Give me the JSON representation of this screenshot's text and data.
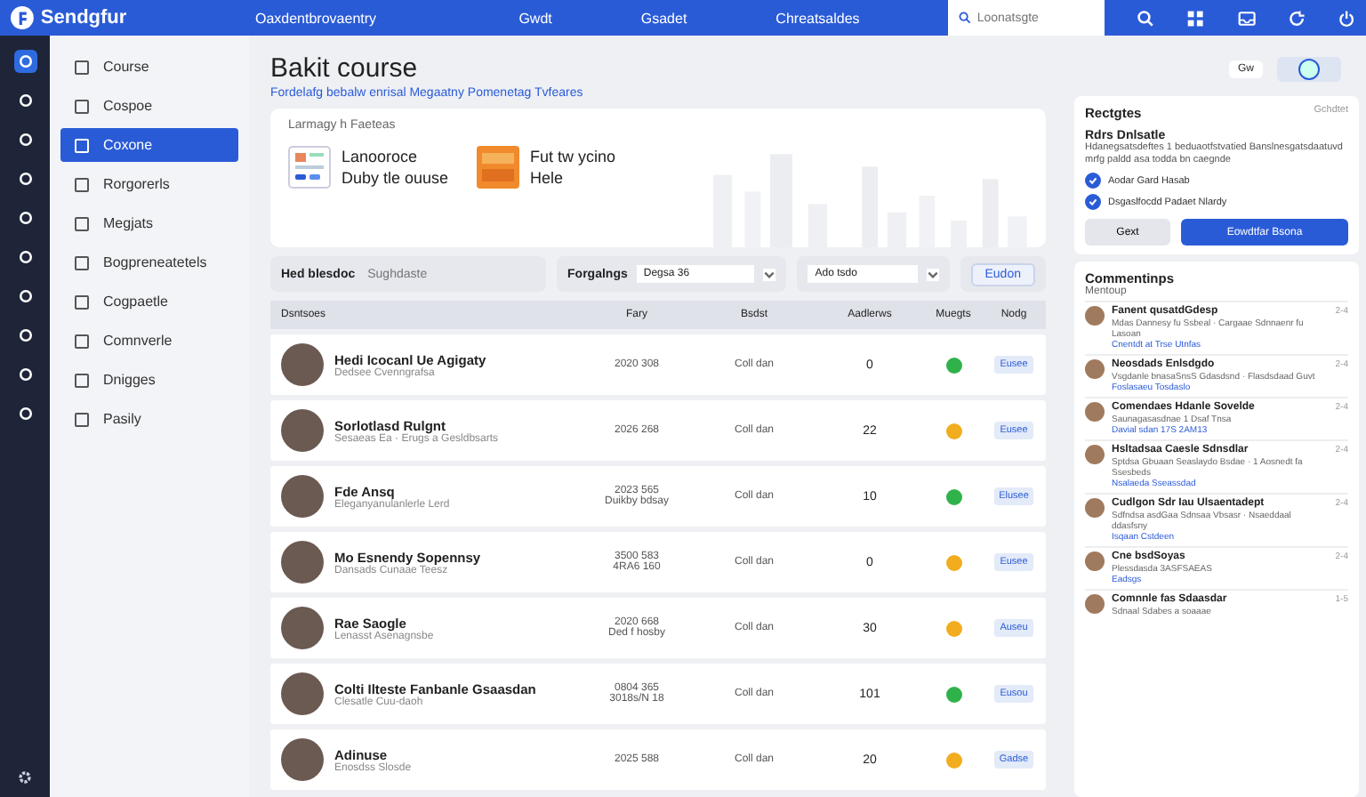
{
  "topbar": {
    "logo": "Sendgfur",
    "breadcrumb": "Oaxdentbrovaentry",
    "nav": [
      {
        "label": "Gwdt"
      },
      {
        "label": "Gsadet"
      },
      {
        "label": "Chreatsaldes"
      }
    ],
    "search": {
      "placeholder": "Loonatsgte"
    }
  },
  "rail": {
    "items": [
      {
        "selected": true
      },
      {
        "selected": false
      },
      {
        "selected": false
      },
      {
        "selected": false
      },
      {
        "selected": false
      },
      {
        "selected": false
      },
      {
        "selected": false
      },
      {
        "selected": false
      },
      {
        "selected": false
      },
      {
        "selected": false
      }
    ]
  },
  "sidebar": {
    "items": [
      {
        "label": "Course",
        "selected": false
      },
      {
        "label": "Cospoe",
        "selected": false
      },
      {
        "label": "Coxone",
        "selected": true
      },
      {
        "label": "Rorgorerls",
        "selected": false
      },
      {
        "label": "Megjats",
        "selected": false
      },
      {
        "label": "Bogpreneatetels",
        "selected": false
      },
      {
        "label": "Cogpaetle",
        "selected": false
      },
      {
        "label": "Comnverle",
        "selected": false
      },
      {
        "label": "Dnigges",
        "selected": false
      },
      {
        "label": "Pasily",
        "selected": false
      }
    ]
  },
  "page": {
    "title": "Bakit course",
    "subtitle": "Fordelafg bebalw enrisal Megaatny Pomenetag Tvfeares",
    "chip": "Gw"
  },
  "learning": {
    "title": "Larmagy h Faeteas",
    "items": [
      {
        "kind": "calendar",
        "line1": "Lanooroce",
        "line2": "Duby tle ouuse"
      },
      {
        "kind": "video",
        "line1": "Fut tw ycino",
        "line2": "Hele"
      }
    ]
  },
  "filters": {
    "label": "Hed blesdoc",
    "placeholder": "Sughdaste",
    "select_label": "Forgalngs",
    "select_1": "Degsa 36",
    "select_2": "Ado tsdo",
    "button": "Eudon"
  },
  "table": {
    "columns": [
      "Dsntsoes",
      "Fary",
      "Bsdst",
      "Aadlerws",
      "Muegts",
      "Nodg"
    ],
    "rows": [
      {
        "name": "Hedi Icocanl Ue Agigaty",
        "sub": "Dedsee Cvenngrafsa",
        "fary": [
          "2020 308"
        ],
        "bsdst": "Coll dan",
        "count": "0",
        "color": "#2fb24a",
        "tag": "Eusee"
      },
      {
        "name": "Sorlotlasd Rulgnt",
        "sub": "Sesaeas Ea · Erugs a Gesldbsarts",
        "fary": [
          "2026 268"
        ],
        "bsdst": "Coll dan",
        "count": "22",
        "color": "#f2ad1f",
        "tag": "Eusee"
      },
      {
        "name": "Fde Ansq",
        "sub": "Eleganyanulanlerle Lerd",
        "fary": [
          "2023 565",
          "Duikby bdsay"
        ],
        "bsdst": "Coll dan",
        "count": "10",
        "color": "#2fb24a",
        "tag": "Elusee"
      },
      {
        "name": "Mo Esnendy Sopennsy",
        "sub": "Dansads Cunaae Teesz",
        "fary": [
          "3500 583",
          "4RA6 160"
        ],
        "bsdst": "Coll dan",
        "count": "0",
        "color": "#f2ad1f",
        "tag": "Eusee"
      },
      {
        "name": "Rae Saogle",
        "sub": "Lenasst Asenagnsbe",
        "fary": [
          "2020 668",
          "Ded f hosby"
        ],
        "bsdst": "Coll dan",
        "count": "30",
        "color": "#f2ad1f",
        "tag": "Auseu"
      },
      {
        "name": "Colti Ilteste Fanbanle Gsaasdan",
        "sub": "Clesatle Cuu-daoh",
        "fary": [
          "0804 365",
          "3018s/N 18"
        ],
        "bsdst": "Coll dan",
        "count": "101",
        "color": "#2fb24a",
        "tag": "Eusou"
      },
      {
        "name": "Adinuse",
        "sub": "Enosdss Slosde",
        "fary": [
          "2025 588"
        ],
        "bsdst": "Coll dan",
        "count": "20",
        "color": "#f2ad1f",
        "tag": "Gadse"
      }
    ]
  },
  "requests": {
    "title": "Rectgtes",
    "meta": "Gchdtet",
    "heading": "Rdrs Dnlsatle",
    "text": "Hdanegsatsdeftes 1 beduaotfstvatied Banslnesgatsdaatuvd mrfg paldd asa todda bn caegnde",
    "checks": [
      {
        "label": "Aodar Gard Hasab",
        "checked": true
      },
      {
        "label": "Dsgaslfocdd Padaet Nlardy",
        "checked": true
      }
    ],
    "buttons": [
      {
        "label": "Gext",
        "kind": "secondary"
      },
      {
        "label": "Eowdtfar Bsona",
        "kind": "primary"
      }
    ]
  },
  "comments": {
    "title": "Commentinps",
    "subtitle": "Mentoup",
    "items": [
      {
        "title": "Fanent qusatdGdesp",
        "text": "Mdas Dannesy fu Ssbeal · Cargaae Sdnnaenr fu Lasoan",
        "link": "Cnentdt at Trse Utnfas",
        "time": "2-4"
      },
      {
        "title": "Neosdads Enlsdgdo",
        "text": "Vsgdanle bnasaSnsS Gdasdsnd · Flasdsdaad Guvt",
        "link": "Foslasaeu Tosdaslo",
        "time": "2-4"
      },
      {
        "title": "Comendaes Hdanle Sovelde",
        "text": "Saunagasasdnae 1 Dsaf Tnsa",
        "link": "Davial sdan 17S 2AM13",
        "time": "2-4"
      },
      {
        "title": "Hsltadsaa Caesle Sdnsdlar",
        "text": "Sptdsa Gbuaan Seaslaydo Bsdae · 1 Aosnedt fa Ssesbeds",
        "link": "Nsalaeda Sseassdad",
        "time": "2-4"
      },
      {
        "title": "Cudlgon Sdr Iau Ulsaentadept",
        "text": "Sdfndsa asdGaa Sdnsaa Vbsasr · Nsaeddaal ddasfsny",
        "link": "Isqaan Cstdeen",
        "time": "2-4"
      },
      {
        "title": "Cne bsdSoyas",
        "text": "Plessdasda 3ASFSAEAS",
        "link": "Eadsgs",
        "time": "2-4"
      },
      {
        "title": "Comnnle fas Sdaasdar",
        "text": "Sdnaal Sdabes a soaaae",
        "time": "1-5"
      }
    ]
  }
}
